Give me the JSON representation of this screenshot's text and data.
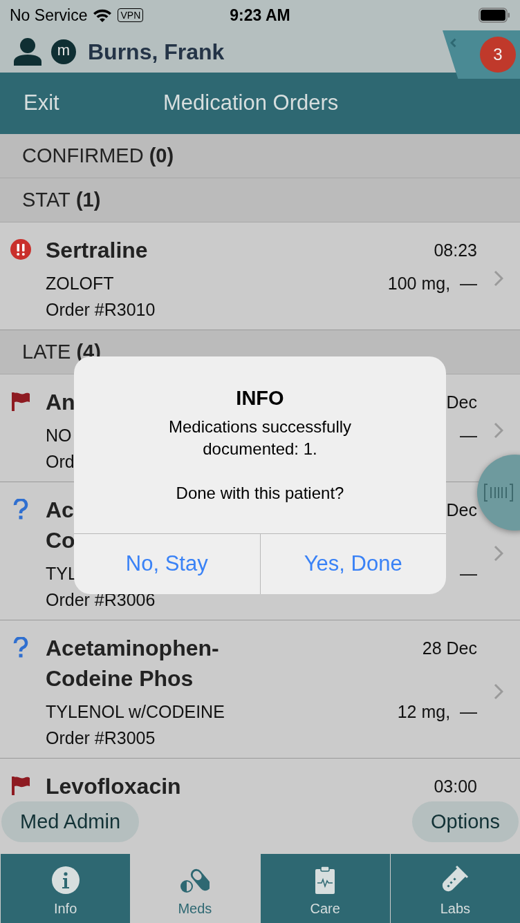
{
  "status_bar": {
    "carrier": "No Service",
    "vpn": "VPN",
    "time": "9:23 AM"
  },
  "patient": {
    "avatar_letter": "m",
    "name": "Burns, Frank",
    "badge_count": "3"
  },
  "nav": {
    "back": "Exit",
    "title": "Medication Orders"
  },
  "sections": [
    {
      "label": "CONFIRMED",
      "count": "(0)"
    },
    {
      "label": "STAT",
      "count": "(1)",
      "orders": [
        {
          "kind": "alert",
          "title": [
            "Sertraline"
          ],
          "time": "08:23",
          "brand": "ZOLOFT",
          "dose": "100 mg,  —",
          "order": "Order #R3010"
        }
      ]
    },
    {
      "label": "LATE",
      "count": "(4)",
      "orders": [
        {
          "kind": "flag",
          "title": [
            "An"
          ],
          "time": "Dec",
          "brand": "NO",
          "dose": "—",
          "order": "Ord"
        },
        {
          "kind": "question",
          "title": [
            "Ac",
            "Co"
          ],
          "time": "Dec",
          "brand": "TYL",
          "dose": "—",
          "order": "Order #R3006"
        },
        {
          "kind": "question",
          "title": [
            "Acetaminophen-",
            "Codeine Phos"
          ],
          "time": "28 Dec",
          "brand": "TYLENOL w/CODEINE",
          "dose": "12 mg,  —",
          "order": "Order #R3005"
        },
        {
          "kind": "flag",
          "title": [
            "Levofloxacin"
          ],
          "time": "03:00"
        }
      ]
    }
  ],
  "actions": {
    "left": "Med Admin",
    "right": "Options"
  },
  "tabs": [
    {
      "label": "Info",
      "selected": false
    },
    {
      "label": "Meds",
      "selected": true
    },
    {
      "label": "Care",
      "selected": false
    },
    {
      "label": "Labs",
      "selected": false
    }
  ],
  "dialog": {
    "title": "INFO",
    "message": "Medications successfully documented: 1.",
    "question": "Done with this patient?",
    "buttons": [
      "No, Stay",
      "Yes, Done"
    ]
  }
}
